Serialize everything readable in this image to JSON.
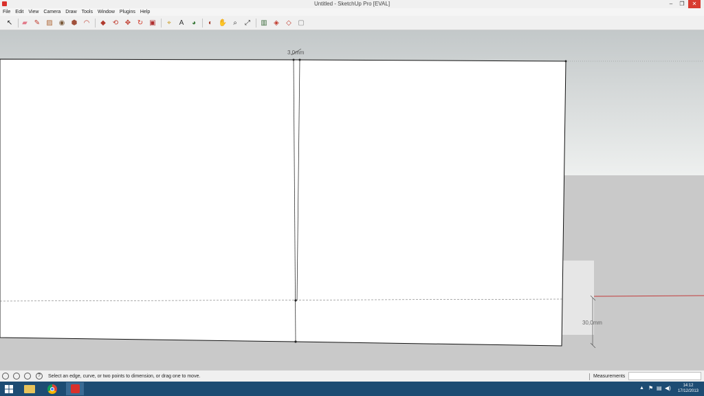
{
  "window": {
    "title": "Untitled - SketchUp Pro [EVAL]",
    "minimize": "–",
    "restore": "❐",
    "close": "✕"
  },
  "menu": [
    "File",
    "Edit",
    "View",
    "Camera",
    "Draw",
    "Tools",
    "Window",
    "Plugins",
    "Help"
  ],
  "toolbar": {
    "tools": [
      {
        "name": "select-tool-icon",
        "glyph": "↖",
        "color": "#222222"
      },
      {
        "name": "eraser-tool-icon",
        "glyph": "▰",
        "color": "#e27a8a"
      },
      {
        "name": "pencil-tool-icon",
        "glyph": "✎",
        "color": "#c0392b"
      },
      {
        "name": "rectangle-tool-icon",
        "glyph": "▨",
        "color": "#b06a3a"
      },
      {
        "name": "circle-tool-icon",
        "glyph": "◉",
        "color": "#7a5a3a"
      },
      {
        "name": "polygon-tool-icon",
        "glyph": "⬢",
        "color": "#a0503a"
      },
      {
        "name": "arc-tool-icon",
        "glyph": "◠",
        "color": "#c0392b"
      },
      {
        "name": "push-pull-tool-icon",
        "glyph": "◆",
        "color": "#b03a2e"
      },
      {
        "name": "follow-me-tool-icon",
        "glyph": "⟲",
        "color": "#c0392b"
      },
      {
        "name": "move-tool-icon",
        "glyph": "✥",
        "color": "#c0392b"
      },
      {
        "name": "rotate-tool-icon",
        "glyph": "↻",
        "color": "#d03a2a"
      },
      {
        "name": "scale-tool-icon",
        "glyph": "▣",
        "color": "#b03030"
      },
      {
        "name": "tape-measure-tool-icon",
        "glyph": "⌖",
        "color": "#c89a20"
      },
      {
        "name": "text-tool-icon",
        "glyph": "A",
        "color": "#333333"
      },
      {
        "name": "paint-bucket-tool-icon",
        "glyph": "◕",
        "color": "#3b7a3b"
      },
      {
        "name": "orbit-tool-icon",
        "glyph": "◐",
        "color": "#a03a2a"
      },
      {
        "name": "pan-tool-icon",
        "glyph": "✋",
        "color": "#555555"
      },
      {
        "name": "zoom-tool-icon",
        "glyph": "⌕",
        "color": "#333333"
      },
      {
        "name": "zoom-extents-tool-icon",
        "glyph": "⤢",
        "color": "#333333"
      },
      {
        "name": "components-icon",
        "glyph": "▥",
        "color": "#3b6a3b"
      },
      {
        "name": "3d-warehouse-icon",
        "glyph": "◈",
        "color": "#c0392b"
      },
      {
        "name": "share-model-icon",
        "glyph": "◇",
        "color": "#c0392b"
      },
      {
        "name": "extension-warehouse-icon",
        "glyph": "▢",
        "color": "#888888"
      }
    ]
  },
  "viewport": {
    "dimension_top": "3,0mm",
    "dimension_right": "30,0mm",
    "colors": {
      "sky_top": "#c3c8c9",
      "sky_bottom": "#eef0ef",
      "ground": "#c9c9c9",
      "face": "#ffffff",
      "red_axis": "#c23a3a"
    }
  },
  "statusbar": {
    "text": "Select an edge, curve, or two points to dimension, or drag one to move.",
    "measurements_label": "Measurements",
    "measurements_value": ""
  },
  "taskbar": {
    "time": "14:12",
    "date": "17/12/2013"
  }
}
